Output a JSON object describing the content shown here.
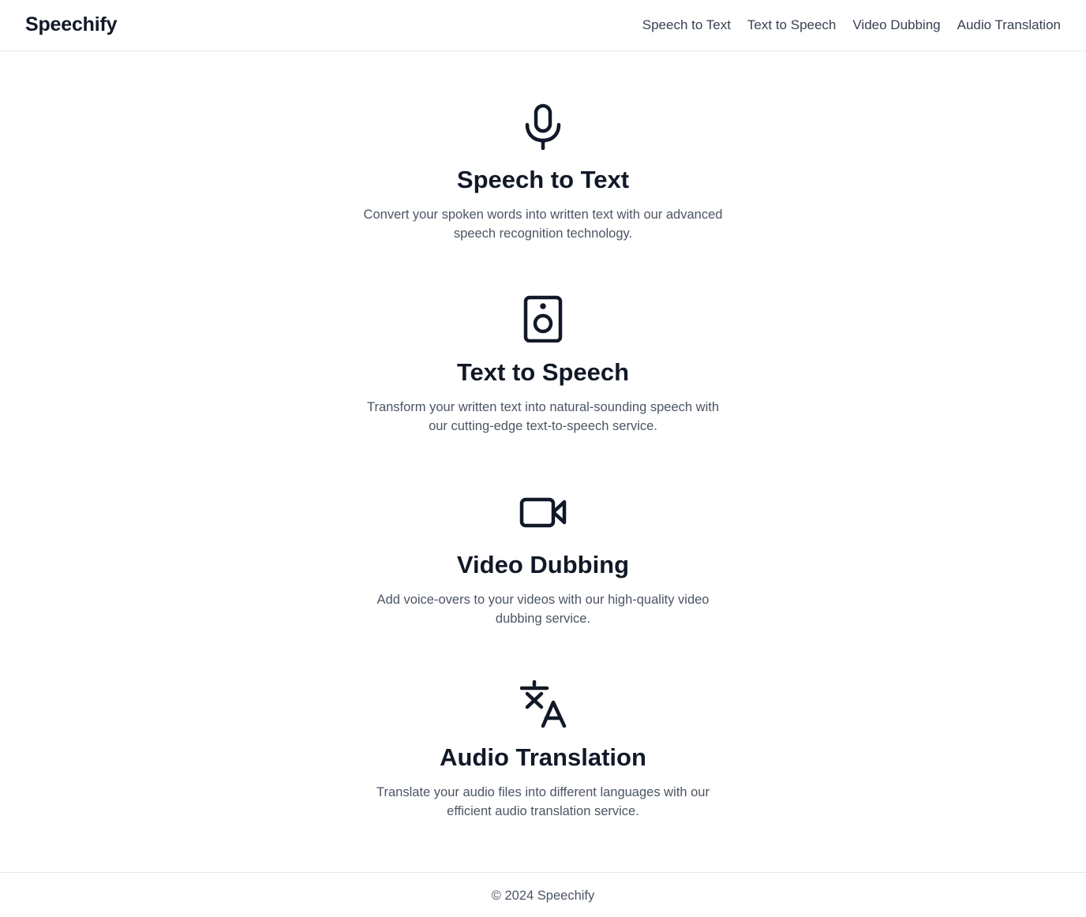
{
  "header": {
    "brand": "Speechify",
    "nav": [
      {
        "label": "Speech to Text"
      },
      {
        "label": "Text to Speech"
      },
      {
        "label": "Video Dubbing"
      },
      {
        "label": "Audio Translation"
      }
    ]
  },
  "features": [
    {
      "icon": "microphone-icon",
      "title": "Speech to Text",
      "description": "Convert your spoken words into written text with our advanced speech recognition technology."
    },
    {
      "icon": "speaker-icon",
      "title": "Text to Speech",
      "description": "Transform your written text into natural-sounding speech with our cutting-edge text-to-speech service."
    },
    {
      "icon": "video-camera-icon",
      "title": "Video Dubbing",
      "description": "Add voice-overs to your videos with our high-quality video dubbing service."
    },
    {
      "icon": "language-icon",
      "title": "Audio Translation",
      "description": "Translate your audio files into different languages with our efficient audio translation service."
    }
  ],
  "footer": {
    "copyright": "© 2024 Speechify"
  },
  "colors": {
    "text": "#111827",
    "muted": "#4b5563",
    "border": "#e5e7eb"
  }
}
